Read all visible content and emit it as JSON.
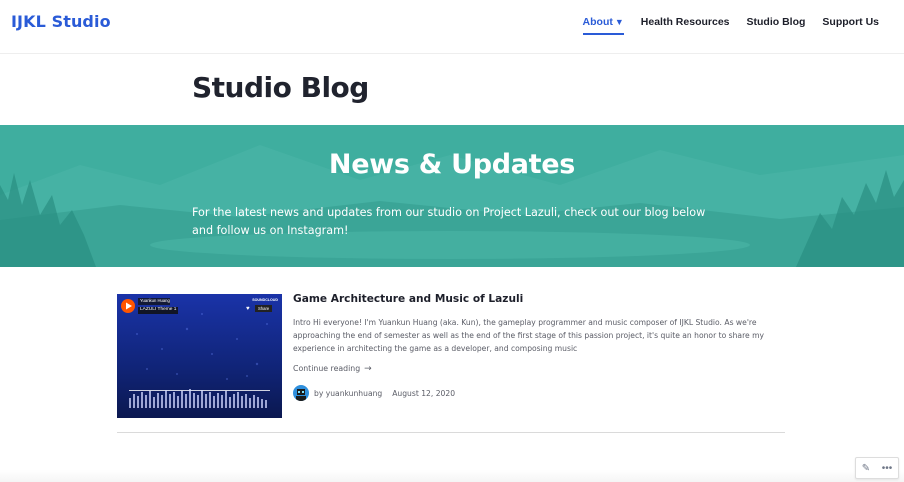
{
  "site": {
    "title": "IJKL Studio"
  },
  "nav": [
    {
      "label": "About",
      "caret": "▼",
      "active": true
    },
    {
      "label": "Health Resources"
    },
    {
      "label": "Studio Blog"
    },
    {
      "label": "Support Us"
    }
  ],
  "page": {
    "title": "Studio Blog"
  },
  "hero": {
    "title": "News & Updates",
    "text": "For the latest news and updates from our studio on Project Lazuli, check out our blog below and follow us on Instagram!"
  },
  "post": {
    "title": "Game Architecture and Music of Lazuli",
    "excerpt": "Intro Hi everyone! I'm Yuankun Huang (aka. Kun), the gameplay programmer and music composer of IJKL Studio. As we're approaching the end of semester as well as the end of the first stage of this passion project, it's quite an honor to share my experience in architecting the game as a developer, and composing music",
    "continue_label": "Continue reading",
    "continue_arrow": "→",
    "author_prefix": "by",
    "author": "yuankunhuang",
    "date": "August 12, 2020",
    "thumbnail": {
      "uploader": "Yuankun Huang",
      "track": "LAZULI Theme 1",
      "brand": "SOUNDCLOUD",
      "share_label": "Share"
    }
  },
  "widget": {
    "edit_icon": "pencil-icon",
    "more_icon": "ellipsis-icon"
  },
  "colors": {
    "accent": "#2a5bd7",
    "hero": "#3aaa9c"
  }
}
